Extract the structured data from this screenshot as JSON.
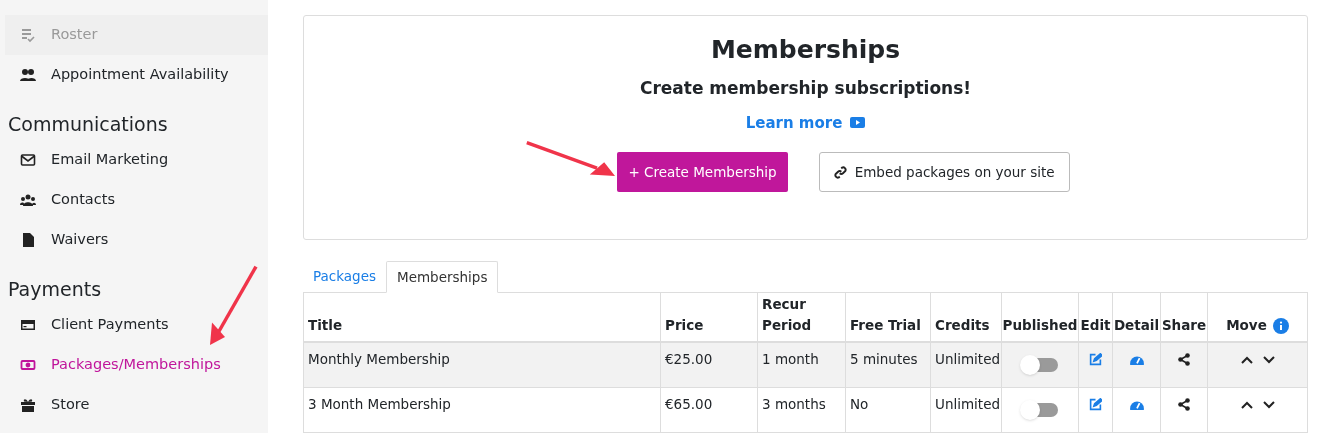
{
  "sidebar": {
    "sections": [
      {
        "items": [
          {
            "label": "Roster",
            "kind": "roster",
            "selected": false,
            "disabled": true
          },
          {
            "label": "Appointment Availability",
            "kind": "people",
            "selected": false,
            "disabled": false
          }
        ]
      },
      {
        "heading": "Communications",
        "items": [
          {
            "label": "Email Marketing",
            "kind": "mail",
            "selected": false,
            "disabled": false
          },
          {
            "label": "Contacts",
            "kind": "group",
            "selected": false,
            "disabled": false
          },
          {
            "label": "Waivers",
            "kind": "file",
            "selected": false,
            "disabled": false
          }
        ]
      },
      {
        "heading": "Payments",
        "items": [
          {
            "label": "Client Payments",
            "kind": "card",
            "selected": false,
            "disabled": false
          },
          {
            "label": "Packages/Memberships",
            "kind": "money",
            "selected": true,
            "disabled": false
          },
          {
            "label": "Store",
            "kind": "gift",
            "selected": false,
            "disabled": false
          }
        ]
      }
    ]
  },
  "header": {
    "title": "Memberships",
    "subtitle": "Create membership subscriptions!",
    "learn_more": "Learn more",
    "create_button": "+ Create Membership",
    "embed_button": "Embed packages on your site"
  },
  "tabs": [
    {
      "label": "Packages",
      "selected": false
    },
    {
      "label": "Memberships",
      "selected": true
    }
  ],
  "table": {
    "columns": [
      "Title",
      "Price",
      "Recur Period",
      "Free Trial",
      "Credits",
      "Published",
      "Edit",
      "Detail",
      "Share",
      "Move"
    ],
    "rows": [
      {
        "title": "Monthly Membership",
        "price": "€25.00",
        "recur": "1 month",
        "trial": "5 minutes",
        "credits": "Unlimited",
        "published": false
      },
      {
        "title": "3 Month Membership",
        "price": "€65.00",
        "recur": "3 months",
        "trial": "No",
        "credits": "Unlimited",
        "published": false
      }
    ]
  }
}
